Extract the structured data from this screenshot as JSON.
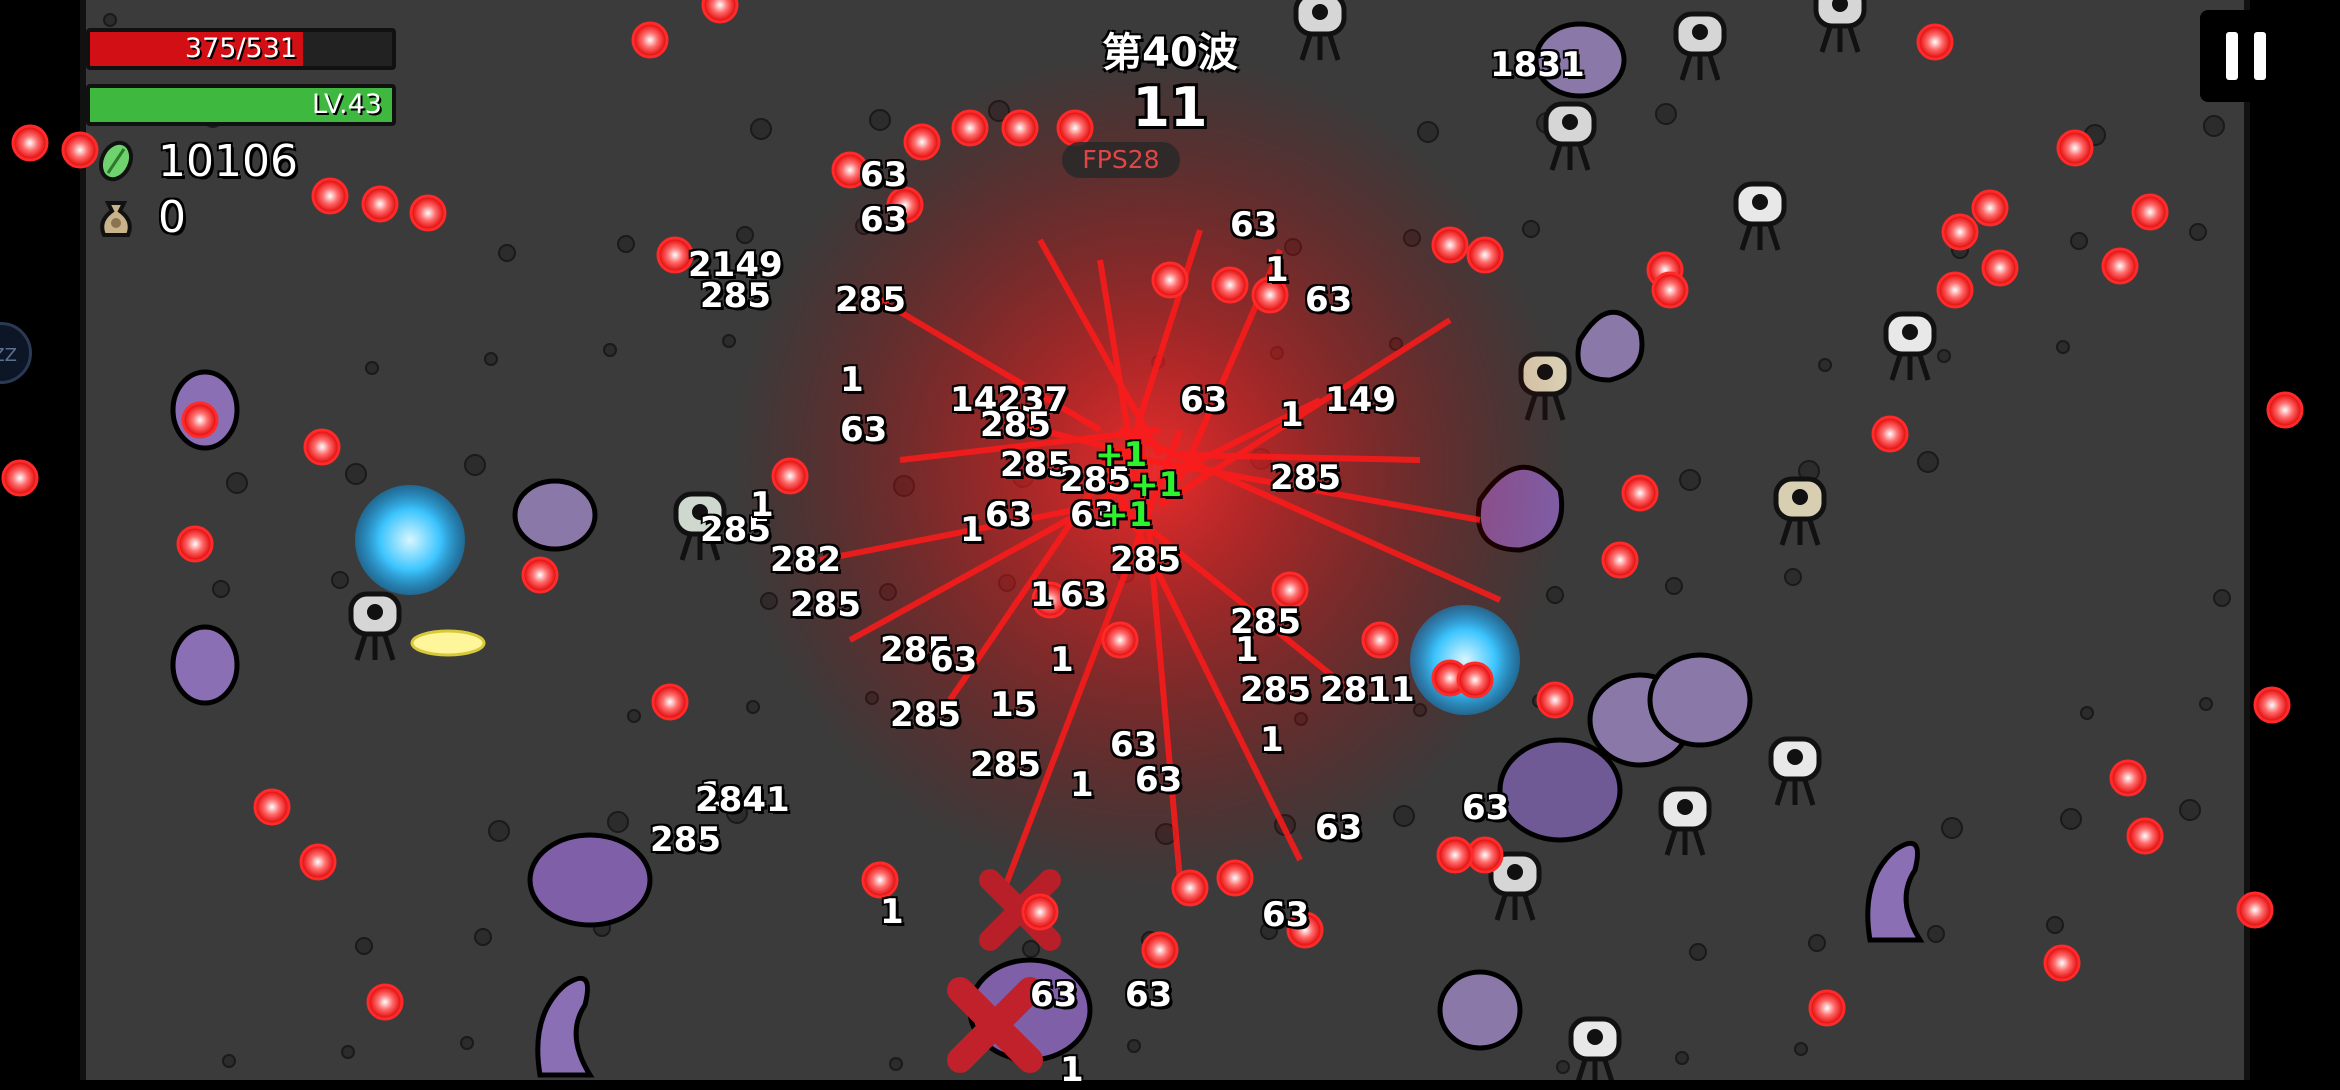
{
  "hud": {
    "hp_text": "375/531",
    "hp_fraction": 0.706,
    "level_text": "LV.43",
    "xp_fraction": 1.0,
    "currency_value": "10106",
    "bag_value": "0",
    "currency_icon": "green-gem-icon",
    "bag_icon": "money-bag-icon"
  },
  "wave": {
    "label": "第40波",
    "timer": "11",
    "fps": "FPS28"
  },
  "controls": {
    "pause_icon": "pause-icon",
    "side_button_text": "ZZ"
  },
  "colors": {
    "hp": "#d10f14",
    "xp": "#3fb83f",
    "fps": "#e24545",
    "bullet": "#ff1e1e",
    "heal_text": "#2ef22e",
    "arena": "#3b3b3b"
  },
  "damage_numbers": [
    "1831",
    "63",
    "63",
    "2149",
    "285",
    "285",
    "63",
    "1",
    "63",
    "149",
    "1",
    "14237",
    "63",
    "1",
    "285",
    "285",
    "63",
    "285",
    "285",
    "1",
    "1",
    "282",
    "1",
    "285",
    "63",
    "2811",
    "285",
    "63",
    "1",
    "285",
    "285",
    "15",
    "285",
    "63",
    "285",
    "1",
    "285",
    "1",
    "63",
    "285",
    "2841",
    "63",
    "63",
    "63",
    "285",
    "1",
    "63",
    "63",
    "1",
    "63",
    "1",
    "63",
    "1"
  ],
  "heal_numbers": [
    "+1",
    "+1",
    "+1"
  ]
}
